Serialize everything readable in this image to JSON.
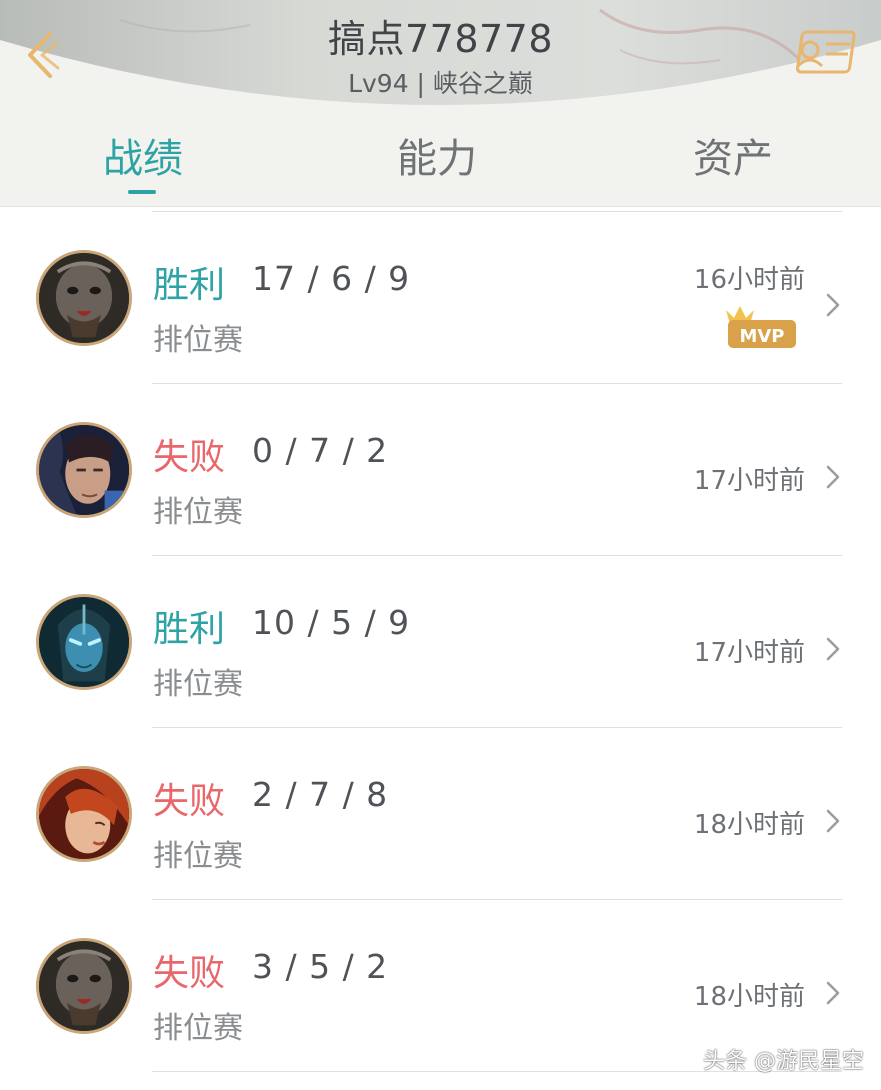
{
  "header": {
    "player_name": "搞点778778",
    "level_text": "Lv94 | 峡谷之巅",
    "accent_color": "#2ea3a6",
    "icons": [
      "back-chevron-icon",
      "player-card-icon"
    ]
  },
  "tabs": [
    {
      "label": "战绩",
      "active": true
    },
    {
      "label": "能力",
      "active": false
    },
    {
      "label": "资产",
      "active": false
    }
  ],
  "matches": [
    {
      "result": "胜利",
      "outcome": "win",
      "kda": "17 / 6 / 9",
      "mode": "排位赛",
      "time": "16小时前",
      "mvp": true,
      "badge_label": "MVP",
      "avatar": "champion-avatar-1"
    },
    {
      "result": "失败",
      "outcome": "loss",
      "kda": "0 / 7 / 2",
      "mode": "排位赛",
      "time": "17小时前",
      "mvp": false,
      "avatar": "champion-avatar-2"
    },
    {
      "result": "胜利",
      "outcome": "win",
      "kda": "10 / 5 / 9",
      "mode": "排位赛",
      "time": "17小时前",
      "mvp": false,
      "avatar": "champion-avatar-3"
    },
    {
      "result": "失败",
      "outcome": "loss",
      "kda": "2 / 7 / 8",
      "mode": "排位赛",
      "time": "18小时前",
      "mvp": false,
      "avatar": "champion-avatar-4"
    },
    {
      "result": "失败",
      "outcome": "loss",
      "kda": "3 / 5 / 2",
      "mode": "排位赛",
      "time": "18小时前",
      "mvp": false,
      "avatar": "champion-avatar-1"
    }
  ],
  "colors": {
    "win": "#2ea3a6",
    "loss": "#e9666b",
    "avatar_ring": "#c9a578",
    "mvp_badge": "#d9a24a"
  },
  "watermark": "头条 @游民星空"
}
